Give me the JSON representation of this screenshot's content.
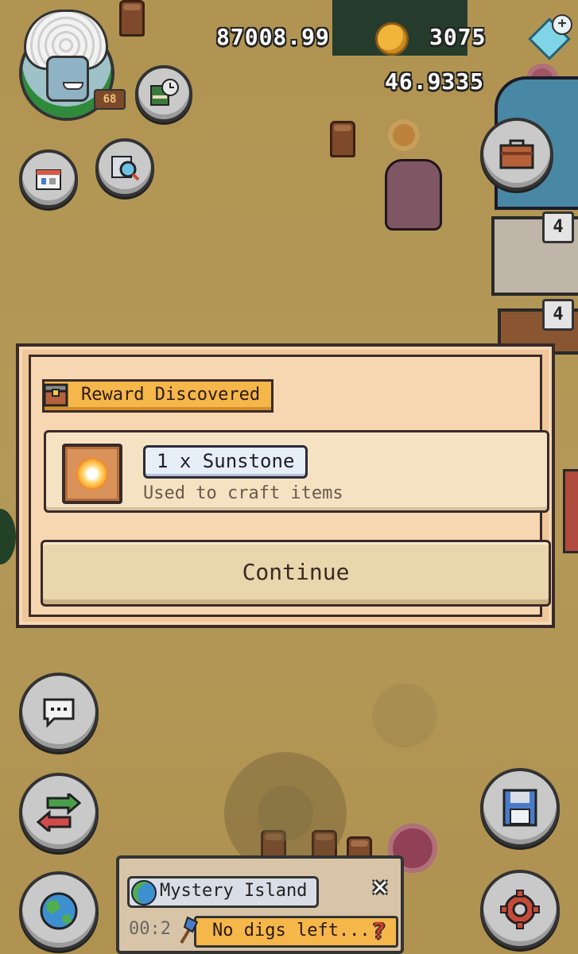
{
  "hud": {
    "coins": "87008.99",
    "gems": "3075",
    "balance": "46.9335",
    "level": "68"
  },
  "badges": {
    "chest_count": "4",
    "crate_count": "4"
  },
  "modal": {
    "title": "Reward Discovered",
    "item_quantity_label": "1 x Sunstone",
    "item_description": "Used to craft items",
    "continue_label": "Continue"
  },
  "island_panel": {
    "name": "Mystery Island",
    "timer": "00:2",
    "digs_status": "No digs left...",
    "help": "?"
  },
  "icons": {
    "coin": "coin-stack-icon",
    "gem": "gem-icon",
    "reward_item": "sunstone-icon"
  }
}
